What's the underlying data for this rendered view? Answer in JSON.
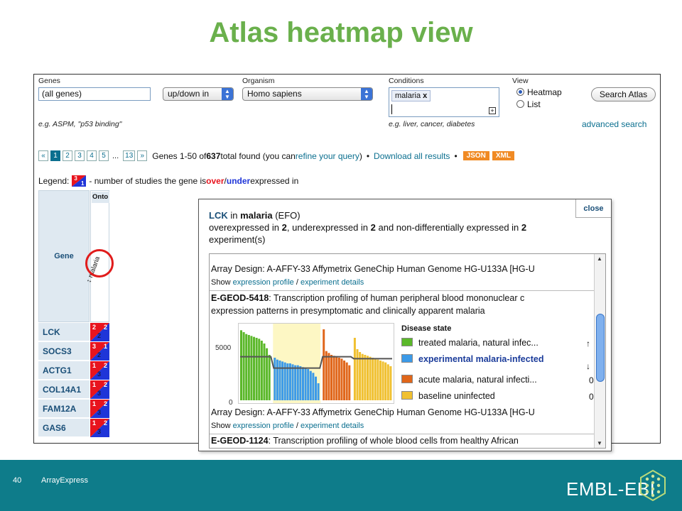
{
  "slide": {
    "title": "Atlas heatmap view",
    "page_number": "40",
    "footer_label": "ArrayExpress",
    "brand": "EMBL-EBI"
  },
  "search": {
    "genes_label": "Genes",
    "genes_value": "(all genes)",
    "direction_value": "up/down in",
    "organism_label": "Organism",
    "organism_value": "Homo sapiens",
    "conditions_label": "Conditions",
    "condition_token": "malaria",
    "token_remove": "x",
    "view_label": "View",
    "view_heatmap": "Heatmap",
    "view_list": "List",
    "search_button": "Search Atlas",
    "genes_hint": "e.g. ASPM, \"p53 binding\"",
    "conditions_hint": "e.g. liver, cancer, diabetes",
    "advanced_link": "advanced search"
  },
  "pager": {
    "prev": "«",
    "pages": [
      "1",
      "2",
      "3",
      "4",
      "5"
    ],
    "ellipsis": "...",
    "last": "13",
    "next": "»",
    "text_pre": "Genes 1-50 of ",
    "total": "637",
    "text_mid": " total found (you can ",
    "refine_link": "refine your query",
    "text_post": ")",
    "bullet": "•",
    "download_link": "Download all results",
    "json_label": "JSON",
    "xml_label": "XML"
  },
  "legend": {
    "label": "Legend:",
    "up_num": "3",
    "down_num": "1",
    "text_pre": "- number of studies the gene is ",
    "over": "over",
    "slash": "/",
    "under": "under",
    "text_post": " expressed in"
  },
  "table": {
    "gene_header": "Gene",
    "onto_header": "Onto",
    "condition_header": "malaria",
    "condition_icon": "↕",
    "rows": [
      {
        "gene": "LCK",
        "up": "2",
        "down": "2",
        "non": "2"
      },
      {
        "gene": "SOCS3",
        "up": "3",
        "down": "1",
        "non": "2"
      },
      {
        "gene": "ACTG1",
        "up": "1",
        "down": "2",
        "non": "3"
      },
      {
        "gene": "COL14A1",
        "up": "1",
        "down": "2",
        "non": "3"
      },
      {
        "gene": "FAM12A",
        "up": "1",
        "down": "2",
        "non": "3"
      },
      {
        "gene": "GAS6",
        "up": "1",
        "down": "2",
        "non": "3"
      }
    ]
  },
  "popup": {
    "close": "close",
    "gene": "LCK",
    "in": " in ",
    "condition": "malaria",
    "efo": " (EFO)",
    "line2_a": "overexpressed in ",
    "over_n": "2",
    "line2_b": ", underexpressed in ",
    "under_n": "2",
    "line2_c": " and non-differentially expressed in ",
    "non_n": "2",
    "line3": "experiment(s)",
    "array_design_1": "Array Design: A-AFFY-33 Affymetrix GeneChip Human Genome HG-U133A [HG-U",
    "show": "Show ",
    "expr_profile": "expression profile",
    "slash": " / ",
    "exp_details": "experiment details",
    "exp1_id": "E-GEOD-5418",
    "exp1_title": ": Transcription profiling of human peripheral blood mononuclear c",
    "exp1_line2": "expression patterns in presymptomatic and clinically apparent malaria",
    "array_design_2": "Array Design: A-AFFY-33 Affymetrix GeneChip Human Genome HG-U133A [HG-U",
    "exp2_id": "E-GEOD-1124",
    "exp2_title": ": Transcription profiling of whole blood cells from healthy African",
    "legend_title": "Disease state",
    "arrow_up": "↑",
    "arrow_down": "↓",
    "side_0a": "0",
    "side_0b": "0"
  },
  "chart_data": {
    "type": "bar",
    "title": "",
    "xlabel": "",
    "ylabel": "",
    "ylim": [
      0,
      7800
    ],
    "yticks": [
      "5000",
      "0"
    ],
    "series": [
      {
        "name": "treated malaria, natural infec...",
        "color": "#5bb82a",
        "values": [
          7400,
          7200,
          7000,
          6900,
          6800,
          6700,
          6600,
          6500,
          6300,
          6000,
          5500,
          4800
        ]
      },
      {
        "name": "experimental malaria-infected",
        "color": "#3c9ae8",
        "highlight": true,
        "values": [
          4500,
          4300,
          4200,
          4100,
          4000,
          3900,
          3900,
          3800,
          3700,
          3700,
          3600,
          3500,
          3400,
          3300,
          3100,
          2900,
          2500,
          1800
        ]
      },
      {
        "name": "acute malaria, natural infecti...",
        "color": "#e0661a",
        "values": [
          7500,
          5200,
          5000,
          4800,
          4700,
          4600,
          4500,
          4400,
          4200,
          4000,
          3700
        ]
      },
      {
        "name": "baseline uninfected",
        "color": "#f0c030",
        "values": [
          6600,
          5400,
          5100,
          4900,
          4800,
          4700,
          4600,
          4500,
          4400,
          4300,
          4200,
          4100,
          4000,
          3800,
          3600
        ]
      }
    ],
    "mean_line": [
      4600,
      3400,
      4600,
      4400
    ],
    "highlight_region_color": "#fdf7c4"
  },
  "colors": {
    "title_green": "#6ab04c",
    "over_red": "#e8141e",
    "under_blue": "#1f35d8",
    "link_teal": "#0b6f8f",
    "bar_bottom": "#0e7c8a",
    "format_orange": "#f08a24"
  }
}
